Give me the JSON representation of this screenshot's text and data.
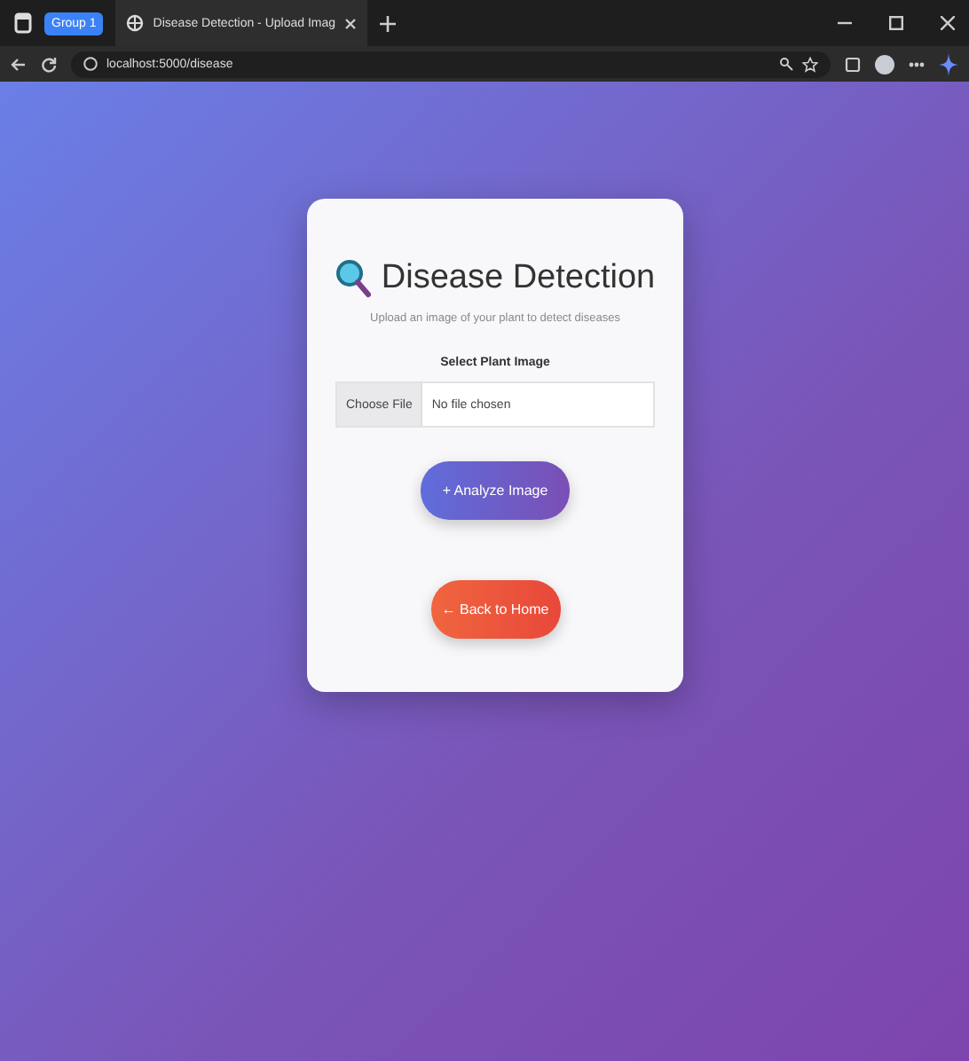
{
  "browser": {
    "tab_group": "Group 1",
    "tabs": [
      {
        "title": "Disease Detection - Upload Imag",
        "selected": true
      }
    ],
    "url": "localhost:5000/disease"
  },
  "card": {
    "title": "Disease Detection",
    "subtitle": "Upload an image of your plant to detect diseases",
    "field_label": "Select Plant Image",
    "file_button": "Choose File",
    "file_status": "No file chosen",
    "buttons": [
      {
        "kind": "primary",
        "icon": "+",
        "label": "Analyze Image"
      },
      {
        "kind": "danger",
        "icon": "←",
        "label": "Back to Home"
      }
    ]
  }
}
